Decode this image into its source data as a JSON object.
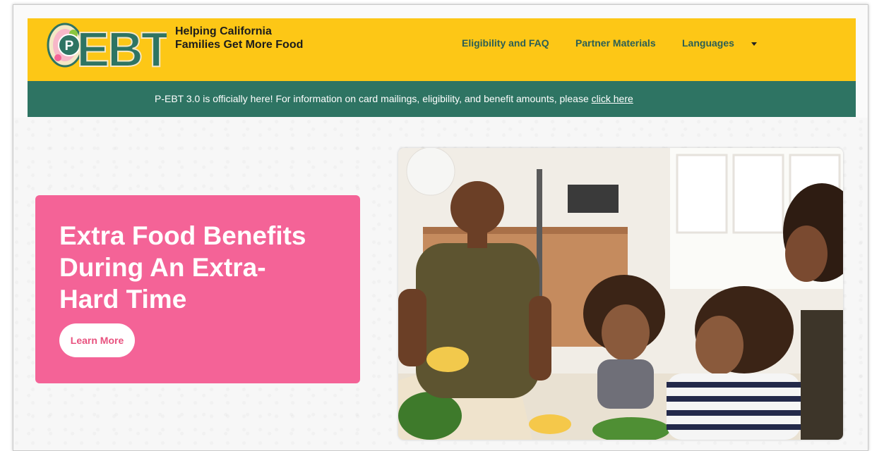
{
  "header": {
    "logo_text": "EBT",
    "logo_letter": "P",
    "tagline_line1": "Helping California",
    "tagline_line2": "Families Get More Food",
    "nav": [
      {
        "label": "Eligibility and FAQ"
      },
      {
        "label": "Partner Materials"
      },
      {
        "label": "Languages"
      }
    ]
  },
  "banner": {
    "text": "P-EBT 3.0 is officially here! For information on card mailings, eligibility, and benefit amounts, please ",
    "link_label": "click here"
  },
  "hero": {
    "title_line1": "Extra Food Benefits",
    "title_line2": "During An Extra-",
    "title_line3": "Hard Time",
    "button_label": "Learn More"
  },
  "colors": {
    "header_bg": "#fdc716",
    "banner_bg": "#2e7463",
    "hero_card_bg": "#f46397",
    "nav_text": "#2b5f55"
  }
}
